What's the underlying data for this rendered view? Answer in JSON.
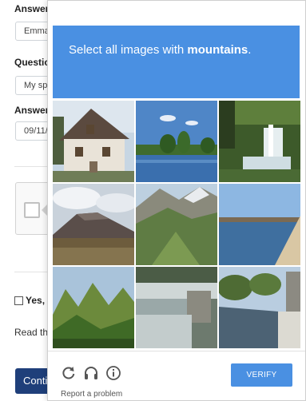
{
  "form": {
    "answer1_label": "Answer",
    "answer1_value": "Emma",
    "question_label": "Questio",
    "question_value": "My sp",
    "answer2_label": "Answer",
    "answer2_value": "09/11/",
    "consent_text": "Yes, I",
    "read_text": "Read th",
    "continue_label": "Conti"
  },
  "captcha": {
    "prompt_prefix": "Select all images with ",
    "prompt_keyword": "mountains",
    "prompt_suffix": ".",
    "verify_label": "VERIFY",
    "report_label": "Report a problem",
    "colors": {
      "header": "#4a90e2",
      "verify_button": "#4a90e2",
      "continue_button": "#1f3f7a"
    },
    "tiles": [
      {
        "icon": "house-photo"
      },
      {
        "icon": "lake-trees-photo"
      },
      {
        "icon": "waterfall-photo"
      },
      {
        "icon": "mountain-photo"
      },
      {
        "icon": "mountain-valley-photo"
      },
      {
        "icon": "lake-shore-photo"
      },
      {
        "icon": "mountain-hills-photo"
      },
      {
        "icon": "weir-water-photo"
      },
      {
        "icon": "canal-photo"
      }
    ],
    "footer_icons": [
      "refresh-icon",
      "headphones-icon",
      "info-icon"
    ]
  }
}
